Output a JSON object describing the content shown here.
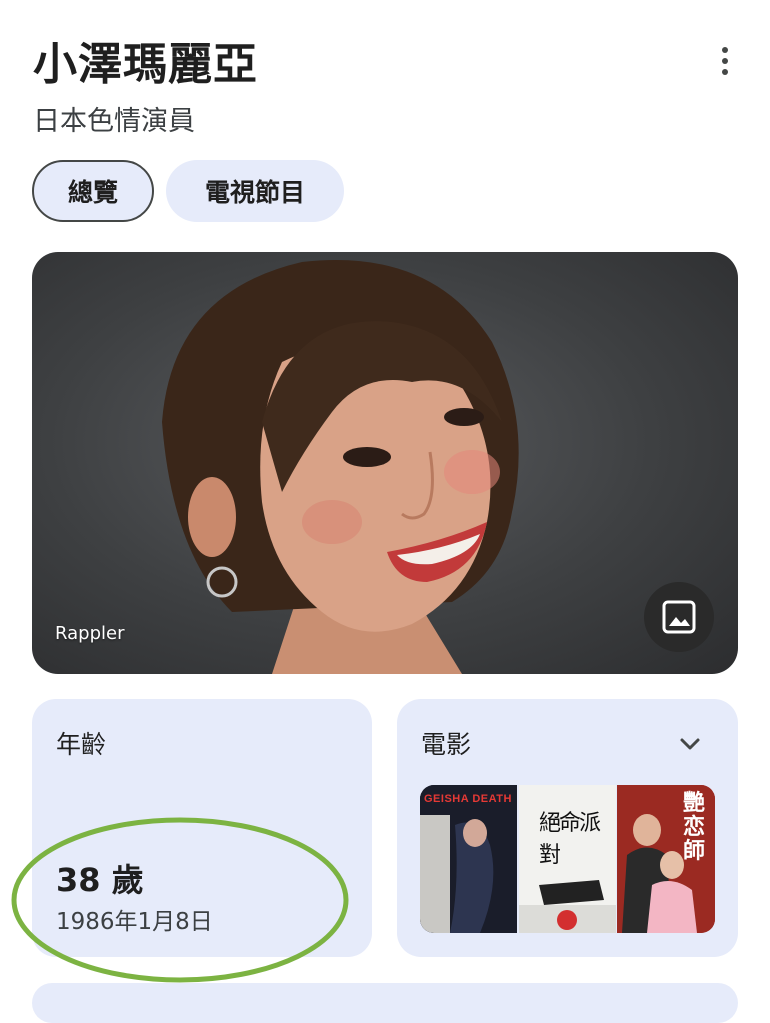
{
  "header": {
    "title": "小澤瑪麗亞",
    "subtitle": "日本色情演員",
    "more_icon": "more-vert-icon"
  },
  "tabs": [
    {
      "label": "總覽",
      "selected": true
    },
    {
      "label": "電視節目",
      "selected": false
    }
  ],
  "photo": {
    "credit": "Rappler",
    "button_icon": "image-icon"
  },
  "age_card": {
    "label": "年齡",
    "value": "38 歲",
    "birth_date": "1986年1月8日",
    "highlight_color": "#7cb342"
  },
  "movies_card": {
    "label": "電影",
    "expand_icon": "chevron-down-icon",
    "posters": [
      {
        "text": "GEISHA DEATH"
      },
      {
        "text": "絕命派對"
      },
      {
        "text": "艷恋師"
      }
    ]
  },
  "colors": {
    "card_bg": "#e6ebfa",
    "text": "#1f1f1f"
  }
}
